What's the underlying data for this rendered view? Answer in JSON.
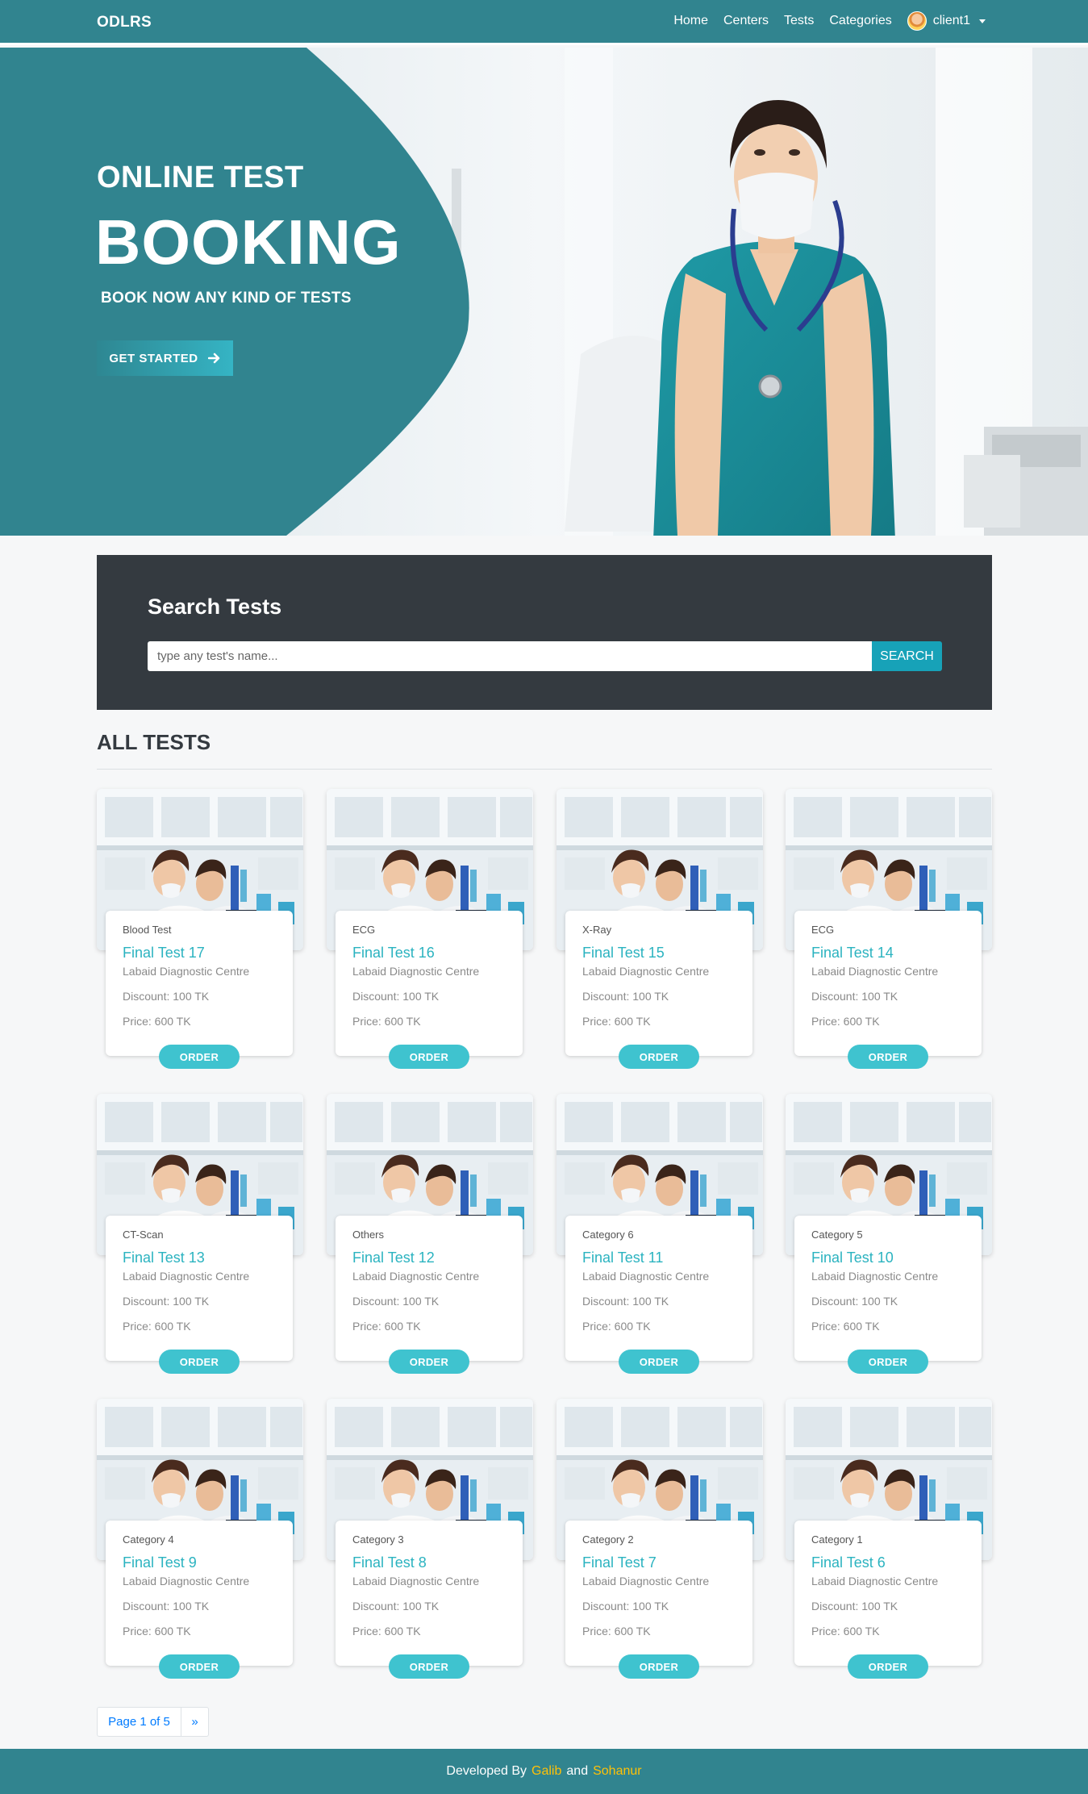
{
  "navbar": {
    "brand": "ODLRS",
    "links": [
      "Home",
      "Centers",
      "Tests",
      "Categories"
    ],
    "user": "client1"
  },
  "hero": {
    "title_small": "ONLINE TEST",
    "title_big": "BOOKING",
    "subtitle": "BOOK NOW ANY KIND OF TESTS",
    "cta": "GET STARTED"
  },
  "search": {
    "title": "Search Tests",
    "placeholder": "type any test's name...",
    "button": "SEARCH"
  },
  "section_title": "ALL TESTS",
  "tests": [
    {
      "category": "Blood Test",
      "name": "Final Test 17",
      "centre": "Labaid Diagnostic Centre",
      "discount": "Discount: 100 TK",
      "price": "Price: 600 TK",
      "order": "ORDER"
    },
    {
      "category": "ECG",
      "name": "Final Test 16",
      "centre": "Labaid Diagnostic Centre",
      "discount": "Discount: 100 TK",
      "price": "Price: 600 TK",
      "order": "ORDER"
    },
    {
      "category": "X-Ray",
      "name": "Final Test 15",
      "centre": "Labaid Diagnostic Centre",
      "discount": "Discount: 100 TK",
      "price": "Price: 600 TK",
      "order": "ORDER"
    },
    {
      "category": "ECG",
      "name": "Final Test 14",
      "centre": "Labaid Diagnostic Centre",
      "discount": "Discount: 100 TK",
      "price": "Price: 600 TK",
      "order": "ORDER"
    },
    {
      "category": "CT-Scan",
      "name": "Final Test 13",
      "centre": "Labaid Diagnostic Centre",
      "discount": "Discount: 100 TK",
      "price": "Price: 600 TK",
      "order": "ORDER"
    },
    {
      "category": "Others",
      "name": "Final Test 12",
      "centre": "Labaid Diagnostic Centre",
      "discount": "Discount: 100 TK",
      "price": "Price: 600 TK",
      "order": "ORDER"
    },
    {
      "category": "Category 6",
      "name": "Final Test 11",
      "centre": "Labaid Diagnostic Centre",
      "discount": "Discount: 100 TK",
      "price": "Price: 600 TK",
      "order": "ORDER"
    },
    {
      "category": "Category 5",
      "name": "Final Test 10",
      "centre": "Labaid Diagnostic Centre",
      "discount": "Discount: 100 TK",
      "price": "Price: 600 TK",
      "order": "ORDER"
    },
    {
      "category": "Category 4",
      "name": "Final Test 9",
      "centre": "Labaid Diagnostic Centre",
      "discount": "Discount: 100 TK",
      "price": "Price: 600 TK",
      "order": "ORDER"
    },
    {
      "category": "Category 3",
      "name": "Final Test 8",
      "centre": "Labaid Diagnostic Centre",
      "discount": "Discount: 100 TK",
      "price": "Price: 600 TK",
      "order": "ORDER"
    },
    {
      "category": "Category 2",
      "name": "Final Test 7",
      "centre": "Labaid Diagnostic Centre",
      "discount": "Discount: 100 TK",
      "price": "Price: 600 TK",
      "order": "ORDER"
    },
    {
      "category": "Category 1",
      "name": "Final Test 6",
      "centre": "Labaid Diagnostic Centre",
      "discount": "Discount: 100 TK",
      "price": "Price: 600 TK",
      "order": "ORDER"
    }
  ],
  "pagination": {
    "current": "Page 1 of 5",
    "next": "»"
  },
  "footer": {
    "prefix": "Developed By",
    "dev1": "Galib",
    "conj": "and",
    "dev2": "Sohanur"
  },
  "colors": {
    "primary_teal": "#31848f",
    "accent_cyan": "#3fc3cf",
    "dark_panel": "#343a40",
    "footer_highlight": "#ffc107"
  },
  "icons": {
    "cta_arrow": "arrow-right-icon",
    "user_caret": "caret-down-icon"
  }
}
